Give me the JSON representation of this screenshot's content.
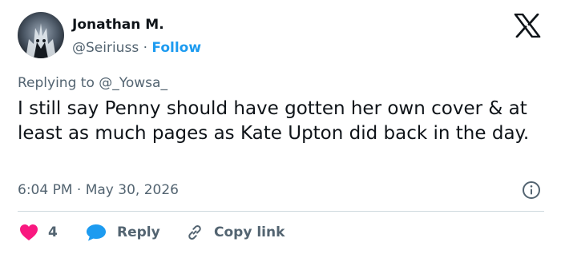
{
  "tweet": {
    "author": {
      "display_name": "Jonathan M.",
      "handle": "@Seiriuss",
      "separator": "·",
      "follow_label": "Follow"
    },
    "replying_to": "Replying to @_Yowsa_",
    "text": "I still say Penny should have gotten her own cover & at least as much pages as Kate Upton did back in the day.",
    "time": "6:04 PM",
    "date": "May 30, 2026",
    "meta_separator": "·",
    "actions": {
      "like_count": "4",
      "reply_label": "Reply",
      "copy_link_label": "Copy link"
    }
  },
  "colors": {
    "text": "#0f1419",
    "secondary": "#536471",
    "accent": "#1d9bf0",
    "like": "#f91880",
    "divider": "#cfd9de"
  },
  "icons": {
    "brand": "x-logo-icon",
    "info": "info-icon",
    "like": "heart-icon",
    "reply": "speech-bubble-icon",
    "copy_link": "link-icon"
  }
}
